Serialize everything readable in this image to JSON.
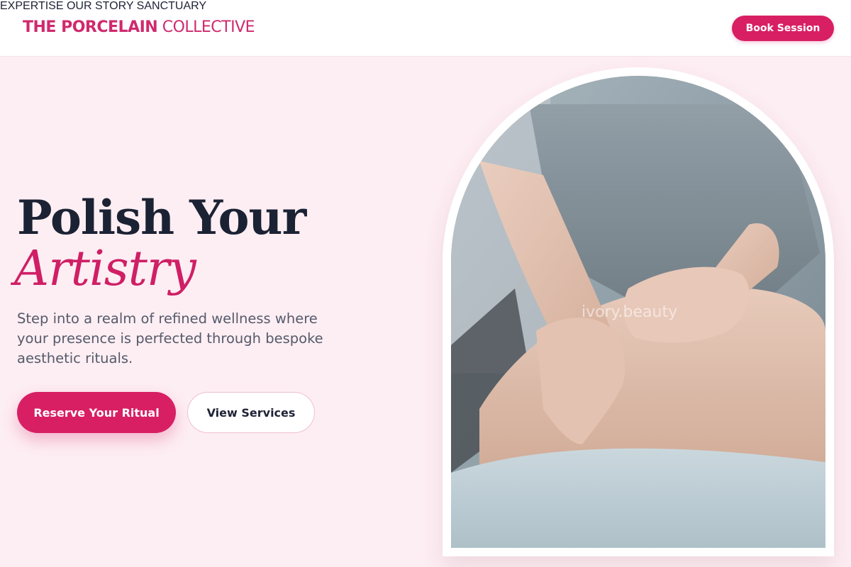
{
  "brand": {
    "bold": "THE PORCELAIN",
    "light": "COLLECTIVE"
  },
  "nav": {
    "items": [
      {
        "label": "EXPERTISE"
      },
      {
        "label": "OUR STORY"
      },
      {
        "label": "SANCTUARY"
      }
    ],
    "cta_label": "Book Session"
  },
  "hero": {
    "title_line1": "Polish Your",
    "title_line2": "Artistry",
    "lead": "Step into a realm of refined wellness where your presence is perfected through bespoke aesthetic rituals.",
    "primary_label": "Reserve Your Ritual",
    "secondary_label": "View Services"
  },
  "image": {
    "watermark": "ivory.beauty",
    "icon": "massage-photo"
  },
  "colors": {
    "accent": "#d81f64",
    "background": "#fdeef3",
    "heading": "#1b2233"
  }
}
